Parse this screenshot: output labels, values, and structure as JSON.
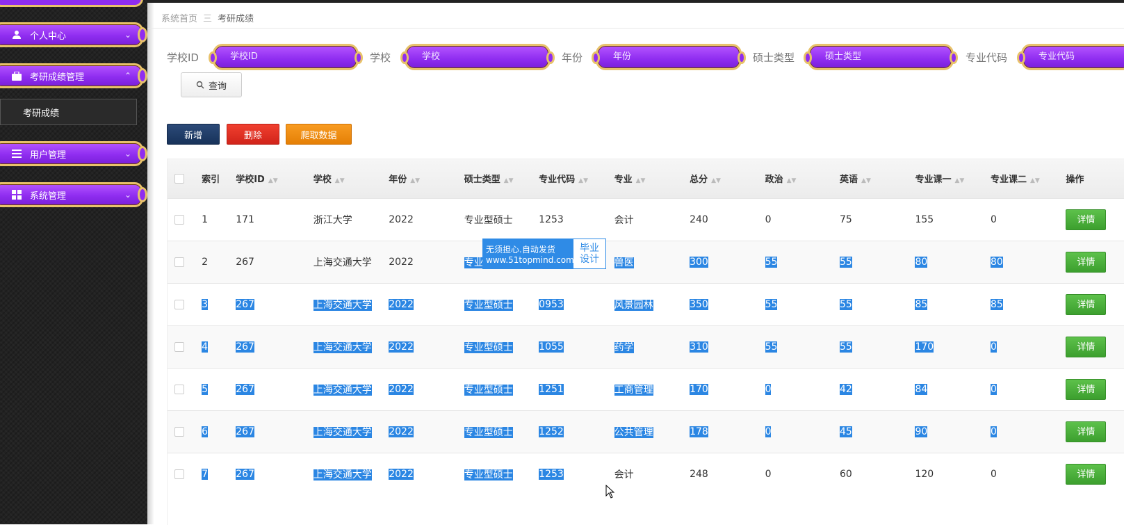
{
  "sidebar": {
    "items": [
      {
        "label": "个人中心"
      },
      {
        "label": "考研成绩管理"
      },
      {
        "label": "用户管理"
      },
      {
        "label": "系统管理"
      }
    ],
    "submenu": {
      "label": "考研成绩"
    }
  },
  "breadcrumb": {
    "home": "系统首页",
    "separator": "三",
    "current": "考研成绩"
  },
  "search": {
    "school_id": {
      "label": "学校ID",
      "placeholder": "学校ID"
    },
    "school": {
      "label": "学校",
      "placeholder": "学校"
    },
    "year": {
      "label": "年份",
      "placeholder": "年份"
    },
    "degree_type": {
      "label": "硕士类型",
      "placeholder": "硕士类型"
    },
    "major_code": {
      "label": "专业代码",
      "placeholder": "专业代码"
    },
    "query_label": "查询"
  },
  "actions": {
    "add": "新增",
    "delete": "删除",
    "crawl": "爬取数据"
  },
  "table": {
    "columns": [
      "索引",
      "学校ID",
      "学校",
      "年份",
      "硕士类型",
      "专业代码",
      "专业",
      "总分",
      "政治",
      "英语",
      "专业课一",
      "专业课二",
      "操作"
    ],
    "detail_label": "详情",
    "rows": [
      [
        "1",
        "171",
        "浙江大学",
        "2022",
        "专业型硕士",
        "1253",
        "会计",
        "240",
        "0",
        "75",
        "155",
        "0"
      ],
      [
        "2",
        "267",
        "上海交通大学",
        "2022",
        "专业型硕士",
        "",
        "兽医",
        "300",
        "55",
        "55",
        "80",
        "80"
      ],
      [
        "3",
        "267",
        "上海交通大学",
        "2022",
        "专业型硕士",
        "0953",
        "风景园林",
        "350",
        "55",
        "55",
        "85",
        "85"
      ],
      [
        "4",
        "267",
        "上海交通大学",
        "2022",
        "专业型硕士",
        "1055",
        "药学",
        "310",
        "55",
        "55",
        "170",
        "0"
      ],
      [
        "5",
        "267",
        "上海交通大学",
        "2022",
        "专业型硕士",
        "1251",
        "工商管理",
        "170",
        "0",
        "42",
        "84",
        "0"
      ],
      [
        "6",
        "267",
        "上海交通大学",
        "2022",
        "专业型硕士",
        "1252",
        "公共管理",
        "178",
        "0",
        "45",
        "90",
        "0"
      ],
      [
        "7",
        "267",
        "上海交通大学",
        "2022",
        "专业型硕士",
        "1253",
        "会计",
        "248",
        "0",
        "60",
        "120",
        "0"
      ]
    ]
  },
  "watermark": {
    "line1": "无须担心.自动发货",
    "line2": "www.51topmind.com",
    "tag1": "毕业",
    "tag2": "设计"
  },
  "colors": {
    "accent_purple": "#8f2df0",
    "gold_border": "#e8c26a",
    "selection_blue": "#2b86e3",
    "add_btn": "#1f3a63",
    "delete_btn": "#e02b1d",
    "crawl_btn": "#f08a0a",
    "detail_btn": "#4cae3a"
  }
}
